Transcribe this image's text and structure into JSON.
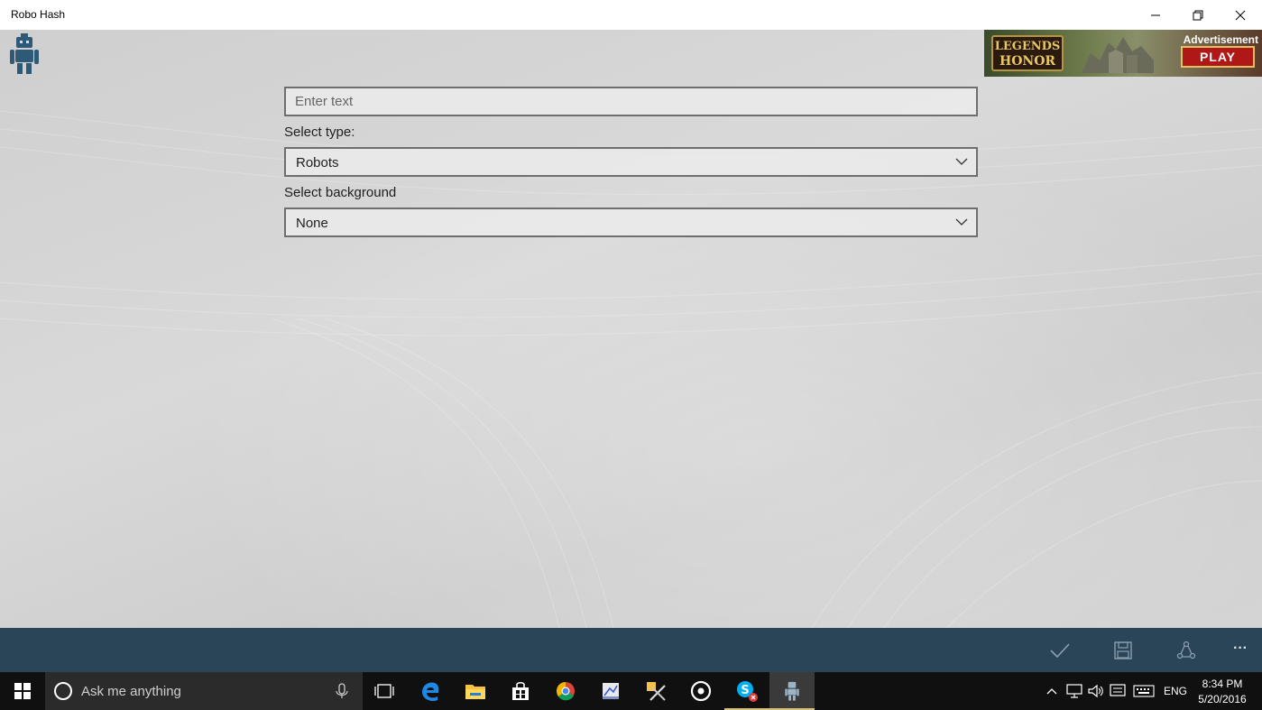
{
  "window": {
    "title": "Robo Hash",
    "controls": [
      "minimize-icon",
      "restore-icon",
      "close-icon"
    ]
  },
  "app": {
    "logo_icon": "robot-icon",
    "text_input": {
      "value": "",
      "placeholder": "Enter text"
    },
    "type_label": "Select type:",
    "type_select": {
      "value": "Robots"
    },
    "background_label": "Select background",
    "background_select": {
      "value": "None"
    }
  },
  "advertisement": {
    "label": "Advertisement",
    "brand_line1": "LEGENDS",
    "brand_line2": "HONOR",
    "cta": "PLAY"
  },
  "appbar": {
    "buttons": [
      "checkmark-icon",
      "save-icon",
      "share-icon",
      "more-icon"
    ],
    "more_glyph": "···"
  },
  "taskbar": {
    "search_placeholder": "Ask me anything",
    "apps": [
      "task-view-icon",
      "edge-icon",
      "file-explorer-icon",
      "store-icon",
      "chrome-icon",
      "app-icon",
      "tools-icon",
      "groove-icon",
      "skype-icon",
      "robohash-icon"
    ],
    "tray": {
      "language": "ENG"
    },
    "clock": {
      "time": "8:34 PM",
      "date": "5/20/2016"
    }
  },
  "colors": {
    "appbar": "#2a4558",
    "taskbar": "#101010",
    "logo": "#2e5a78"
  }
}
